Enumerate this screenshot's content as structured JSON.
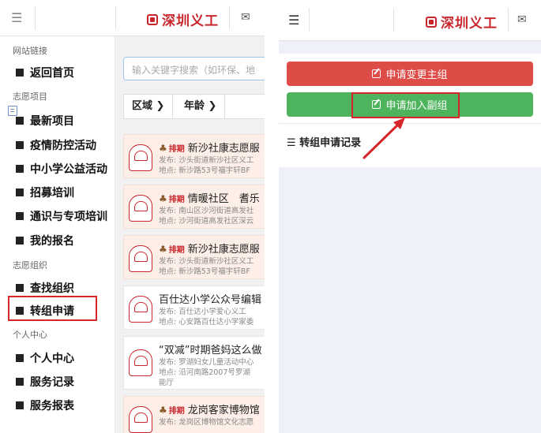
{
  "left": {
    "header": {
      "hamburger": "☰",
      "logo_text": "深圳义工",
      "mail_icon": "✉"
    },
    "sidebar": {
      "sections": [
        {
          "label": "网站链接",
          "items": [
            "返回首页"
          ]
        },
        {
          "label": "志愿项目",
          "items": [
            "最新项目",
            "疫情防控活动",
            "中小学公益活动",
            "招募培训",
            "通识与专项培训",
            "我的报名"
          ]
        },
        {
          "label": "志愿组织",
          "items": [
            "查找组织",
            "转组申请"
          ]
        },
        {
          "label": "个人中心",
          "items": [
            "个人中心",
            "服务记录",
            "服务报表"
          ]
        }
      ],
      "highlighted_item": "转组申请"
    },
    "content": {
      "search_placeholder": "输入关键字搜索（如环保、地",
      "filters": [
        "区域 ❯",
        "年龄 ❯"
      ],
      "cards": [
        {
          "status": "排期",
          "title": "新沙社康志愿服",
          "line1": "发布: 沙头街道新沙社区义工",
          "line2": "地点: 新沙路53号福宇轩BF",
          "style": "orange"
        },
        {
          "status": "排期",
          "title": "情暖社区　耆乐",
          "line1": "发布: 南山区沙河街道高发社",
          "line2": "地点: 沙河街道高发社区深云",
          "style": "orange"
        },
        {
          "status": "排期",
          "title": "新沙社康志愿服",
          "line1": "发布: 沙头街道新沙社区义工",
          "line2": "地点: 新沙路53号福宇轩BF",
          "style": "orange"
        },
        {
          "status": "",
          "title": "百仕达小学公众号编辑",
          "line1": "发布: 百仕达小学爱心义工",
          "line2": "地点: 心安路百仕达小学家委",
          "style": "plain"
        },
        {
          "status": "",
          "title": "“双减”时期爸妈这么做",
          "line1": "发布: 罗湖妇女儿童活动中心",
          "line2": "地点: 沿河南路2007号罗湖",
          "line3": "能厅",
          "style": "plain"
        },
        {
          "status": "排期",
          "title": "龙岗客家博物馆",
          "line1": "发布: 龙岗区博物馆文化志愿",
          "line2": "",
          "style": "orange"
        }
      ]
    }
  },
  "right": {
    "header": {
      "hamburger": "☰",
      "logo_text": "深圳义工",
      "mail_icon": "✉"
    },
    "buttons": {
      "change_main": "申请变更主组",
      "join_sub": "申请加入副组"
    },
    "records_title": "☰ 转组申请记录"
  },
  "colors": {
    "accent_red": "#de4c47",
    "accent_green": "#4db35c",
    "highlight": "#d6262a",
    "brand": "#c9262c"
  }
}
